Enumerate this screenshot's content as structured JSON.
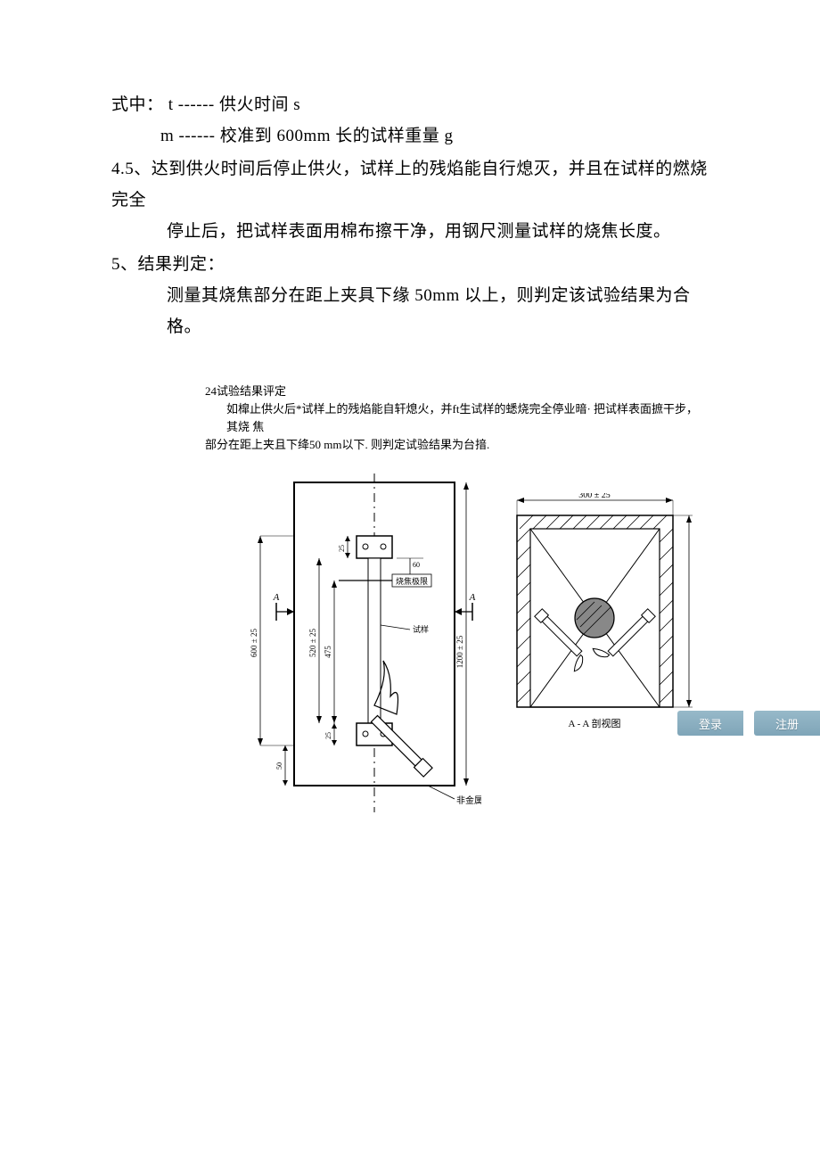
{
  "body": {
    "line1": "式中：  t ------ 供火时间  s",
    "line2": "m ------ 校准到  600mm 长的试样重量  g",
    "sec45_a": "4.5、达到供火时间后停止供火，试样上的残焰能自行熄灭，并且在试样的燃烧完全",
    "sec45_b": "停止后，把试样表面用棉布擦干净，用钢尺测量试样的烧焦长度。",
    "sec5_head": "5、结果判定：",
    "sec5_body": "测量其烧焦部分在距上夹具下缘  50mm 以上，则判定该试验结果为合格。"
  },
  "sub": {
    "title": "24试验结果评定",
    "l1": "如槹止供火后*试样上的残焰能自轩熄火，并ft生试样的蟋烧完全停业暗· 把试样表面摭干步，其烧  焦",
    "l2": "部分在距上夹且下绛50 mm以下. 则判定试验结果为台揞."
  },
  "diagram": {
    "left": {
      "dim_h": "600 ± 25",
      "dim_h2": "520 ± 25",
      "dim_h3": "475",
      "dim_top_gap": "25",
      "dim_bot_gap": "25",
      "dim_bot_base": "50",
      "dim_right": "1200 ± 25",
      "dim_small": "60",
      "label_limit": "烧焦极限",
      "label_sample": "试样",
      "label_a_left": "A",
      "label_a_right": "A",
      "label_base": "非金属底板"
    },
    "right": {
      "dim_top": "300 ± 25",
      "dim_side": "",
      "caption": "A - A 剖视图"
    }
  },
  "buttons": {
    "login": "登录",
    "register": "注册"
  }
}
